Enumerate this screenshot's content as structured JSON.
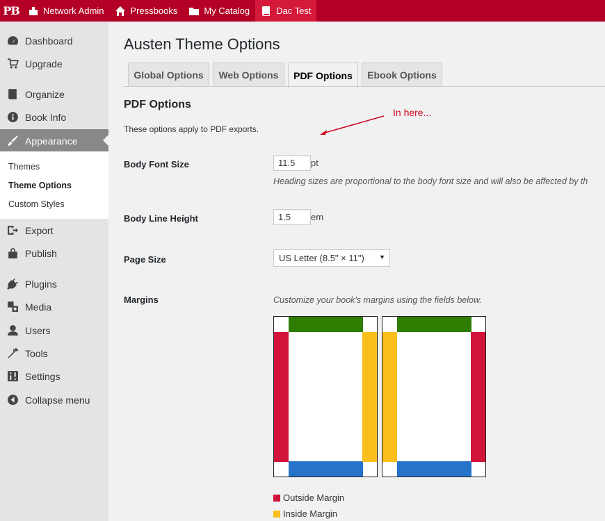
{
  "adminbar": {
    "logo": "PB",
    "items": [
      {
        "label": "Network Admin",
        "icon": "network-icon"
      },
      {
        "label": "Pressbooks",
        "icon": "home-icon"
      },
      {
        "label": "My Catalog",
        "icon": "folder-icon"
      },
      {
        "label": "Dac Test",
        "icon": "book-icon"
      }
    ],
    "colors": {
      "bar": "#b40026",
      "active": "#d5193a"
    }
  },
  "sidebar": {
    "items": [
      {
        "label": "Dashboard",
        "icon": "dashboard-icon"
      },
      {
        "label": "Upgrade",
        "icon": "cart-icon"
      },
      {
        "label": "Organize",
        "icon": "book-icon"
      },
      {
        "label": "Book Info",
        "icon": "info-icon"
      },
      {
        "label": "Appearance",
        "icon": "brush-icon"
      },
      {
        "label": "Export",
        "icon": "export-icon"
      },
      {
        "label": "Publish",
        "icon": "store-icon"
      },
      {
        "label": "Plugins",
        "icon": "plug-icon"
      },
      {
        "label": "Media",
        "icon": "media-icon"
      },
      {
        "label": "Users",
        "icon": "user-icon"
      },
      {
        "label": "Tools",
        "icon": "wrench-icon"
      },
      {
        "label": "Settings",
        "icon": "settings-icon"
      },
      {
        "label": "Collapse menu",
        "icon": "collapse-icon"
      }
    ],
    "current": "Appearance",
    "submenu": [
      "Themes",
      "Theme Options",
      "Custom Styles"
    ],
    "submenu_current": "Theme Options"
  },
  "main": {
    "title": "Austen Theme Options",
    "tabs": [
      "Global Options",
      "Web Options",
      "PDF Options",
      "Ebook Options"
    ],
    "active_tab": "PDF Options",
    "section_title": "PDF Options",
    "description": "These options apply to PDF exports.",
    "annotation": "In here...",
    "fields": {
      "body_font_size": {
        "label": "Body Font Size",
        "value": "11.5",
        "unit": "pt",
        "help": "Heading sizes are proportional to the body font size and will also be affected by th"
      },
      "body_line_height": {
        "label": "Body Line Height",
        "value": "1.5",
        "unit": "em"
      },
      "page_size": {
        "label": "Page Size",
        "value": "US Letter (8.5\" × 11\")"
      },
      "margins": {
        "label": "Margins",
        "help": "Customize your book's margins using the fields below."
      }
    },
    "legend": [
      {
        "label": "Outside Margin",
        "color": "#d2143a"
      },
      {
        "label": "Inside Margin",
        "color": "#fbbf1b"
      }
    ],
    "diagram_colors": {
      "top": "#2e7d00",
      "bottom": "#2673c9",
      "outside": "#d2143a",
      "inside": "#fbbf1b"
    }
  }
}
